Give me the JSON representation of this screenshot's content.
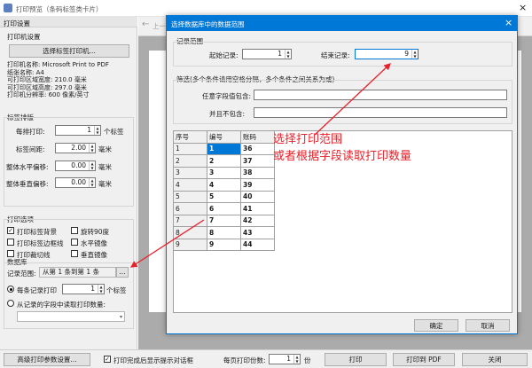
{
  "main_window": {
    "title": "打印预览（条码标签类卡片）",
    "close": "×"
  },
  "left_panel": {
    "title": "打印设置",
    "printer_group": {
      "legend": "打印机设置",
      "select_button": "选择标签打印机...",
      "info_lines": [
        "打印机名称: Microsoft Print to PDF",
        "纸张名称: A4",
        "可打印区域宽度: 210.0 毫米",
        "可打印区域高度: 297.0 毫米",
        "打印机分辨率: 600 像素/英寸"
      ]
    },
    "label_group": {
      "legend": "标签排版",
      "rows": [
        {
          "label": "每排打印:",
          "value": "1",
          "unit": "个标签"
        },
        {
          "label": "标签间距:",
          "value": "2.00",
          "unit": "毫米"
        },
        {
          "label": "整体水平偏移:",
          "value": "0.00",
          "unit": "毫米"
        },
        {
          "label": "整体垂直偏移:",
          "value": "0.00",
          "unit": "毫米"
        }
      ]
    },
    "options_group": {
      "legend": "打印选项",
      "items": [
        {
          "label": "打印标签背景",
          "checked": true
        },
        {
          "label": "旋转90度",
          "checked": false
        },
        {
          "label": "打印标签边框线",
          "checked": false
        },
        {
          "label": "水平镜像",
          "checked": false
        },
        {
          "label": "打印裁切线",
          "checked": false
        },
        {
          "label": "垂直镜像",
          "checked": false
        }
      ]
    },
    "data_group": {
      "legend": "数据库",
      "range_label": "记录范围:",
      "range_value": "从第 1 条到第 1 条",
      "range_button": "...",
      "radio1_label": "每条记录打印",
      "radio1_value": "1",
      "radio1_unit": "个标签",
      "radio2_label": "从记录的字段中读取打印数量:"
    }
  },
  "toolbar": {
    "back": "上一"
  },
  "dialog": {
    "title": "选择数据库中的数据范围",
    "close": "×",
    "range_legend": "记录范围",
    "start_label": "起始记录:",
    "start_value": "1",
    "end_label": "结束记录:",
    "end_value": "9",
    "filter_legend": "筛选(多个条件请用空格分隔，多个条件之间关系为或)",
    "contains_label": "任意字段值包含:",
    "excludes_label": "并且不包含:",
    "grid_headers": [
      "序号",
      "编号",
      "账码"
    ],
    "grid_rows": [
      [
        "1",
        "1",
        "36"
      ],
      [
        "2",
        "2",
        "37"
      ],
      [
        "3",
        "3",
        "38"
      ],
      [
        "4",
        "4",
        "39"
      ],
      [
        "5",
        "5",
        "40"
      ],
      [
        "6",
        "6",
        "41"
      ],
      [
        "7",
        "7",
        "42"
      ],
      [
        "8",
        "8",
        "43"
      ],
      [
        "9",
        "9",
        "44"
      ]
    ],
    "ok": "确定",
    "cancel": "取消"
  },
  "annotation": {
    "line1": "选择打印范围",
    "line2": "或者根据字段读取打印数量"
  },
  "bottom_bar": {
    "advanced_button": "高级打印参数设置...",
    "show_dialog_label": "打印完成后显示提示对话框",
    "copies_label": "每页打印份数:",
    "copies_value": "1",
    "copies_unit": "份",
    "print_button": "打印",
    "pdf_button": "打印到 PDF",
    "close_button": "关闭"
  },
  "colors": {
    "accent": "#0078d7",
    "annotation": "#e8202a"
  }
}
